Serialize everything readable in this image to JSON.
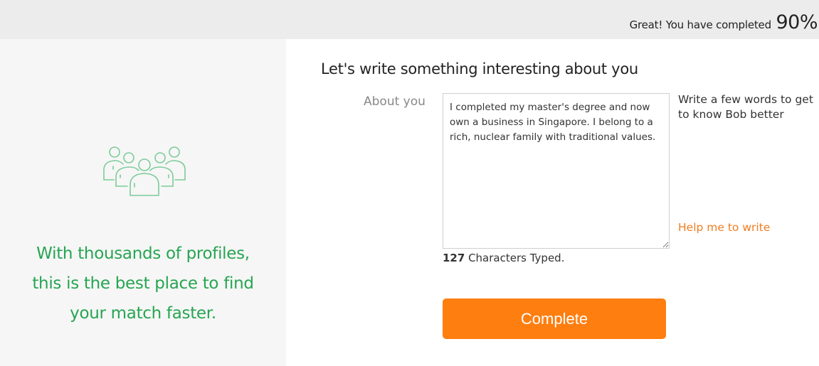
{
  "header": {
    "progress_prefix": "Great! You have completed",
    "progress_value": "90%"
  },
  "left_panel": {
    "icon": "people-group-icon",
    "promo_lines": [
      "With thousands of profiles,",
      "this is the best place to find",
      "your match faster."
    ]
  },
  "form": {
    "heading": "Let's write something interesting about you",
    "about_label": "About you",
    "about_value": "I completed my master's degree and now own a business in Singapore. I belong to a rich, nuclear family with traditional values.",
    "hint": "Write a few words to get to know Bob better",
    "help_link": "Help me to write",
    "char_count": "127",
    "char_count_suffix": " Characters Typed.",
    "submit_label": "Complete"
  },
  "colors": {
    "accent": "#fe7e10",
    "promo_green": "#26a552",
    "icon_green": "#7ccc9a",
    "help_link": "#f07d1f"
  }
}
